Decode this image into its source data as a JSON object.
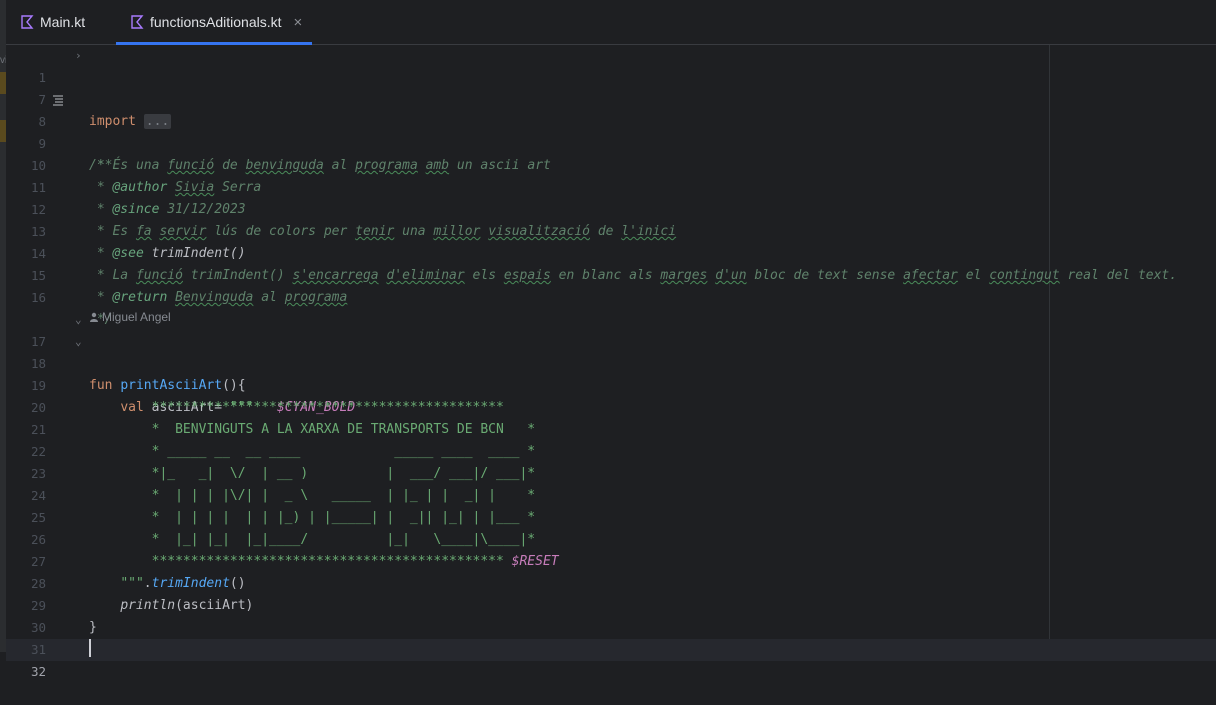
{
  "tabs": [
    {
      "label": "Main.kt",
      "active": false,
      "closable": false
    },
    {
      "label": "functionsAditionals.kt",
      "active": true,
      "closable": true
    }
  ],
  "colors": {
    "background": "#1e1f22",
    "keyword": "#cf8e6d",
    "function": "#56a8f5",
    "doc_comment": "#5f826b",
    "string": "#6aab73",
    "template": "#c77dbb",
    "tab_underline": "#3574f0"
  },
  "editor": {
    "line_numbers": [
      "1",
      "7",
      "8",
      "9",
      "10",
      "11",
      "12",
      "13",
      "14",
      "15",
      "16",
      "17",
      "18",
      "19",
      "20",
      "21",
      "22",
      "23",
      "24",
      "25",
      "26",
      "27",
      "28",
      "29",
      "30",
      "31",
      "32"
    ],
    "import_keyword": "import",
    "import_fold": "...",
    "doc": {
      "open": "/**",
      "l9_prefix": " * ",
      "l9_words": [
        "És",
        "una",
        "funció",
        "de",
        "benvinguda",
        "al",
        "programa",
        "amb",
        "un",
        "ascii",
        "art"
      ],
      "l10_tag": "@author",
      "l10_name1": "Sivia",
      "l10_name2": "Serra",
      "l11_tag": "@since",
      "l11_value": "31/12/2023",
      "l12_words": [
        "Es",
        "fa",
        "servir",
        "lús",
        "de",
        "colors",
        "per",
        "tenir",
        "una",
        "millor",
        "visualització",
        "de",
        "l'inici"
      ],
      "l13_tag": "@see",
      "l13_ref": "trimIndent()",
      "l14_words": [
        "La",
        "funció",
        "trimIndent()",
        "s'encarrega",
        "d'eliminar",
        "els",
        "espais",
        "en",
        "blanc",
        "als",
        "marges",
        "d'un",
        "bloc",
        "de",
        "text",
        "sense",
        "afectar",
        "el",
        "contingut",
        "real",
        "del",
        "text."
      ],
      "l15_tag": "@return",
      "l15_words": [
        "Benvinguda",
        "al",
        "programa"
      ],
      "close": " */"
    },
    "author_inlay": "Miguel Angel",
    "fun_keyword": "fun",
    "fun_name": "printAsciiArt",
    "fun_sig_rest": "(){",
    "val_keyword": "val",
    "val_name": "asciiArt",
    "val_assign": "= ",
    "triple_quote_open": "\"\"\"",
    "template_cyan": "$CYAN_BOLD",
    "ascii_lines": [
      "*********************************************",
      "*  BENVINGUTS A LA XARXA DE TRANSPORTS DE BCN   *",
      "* _____ __  __ ____            _____ ____  ____ *",
      "*|_   _|  \\/  | __ )          |  ___/ ___|/ ___|*",
      "*  | | | |\\/| |  _ \\   _____  | |_ | |  _| |    *",
      "*  | | | |  | | |_) | |_____| |  _|| |_| | |___ *",
      "*  |_| |_|  |_|____/          |_|   \\____|\\____|*",
      "*********************************************"
    ],
    "template_reset": "$RESET",
    "triple_quote_close": "\"\"\"",
    "trim_call": "trimIndent",
    "trim_paren": "()",
    "println": "println",
    "println_args": "(asciiArt)",
    "close_brace": "}"
  }
}
